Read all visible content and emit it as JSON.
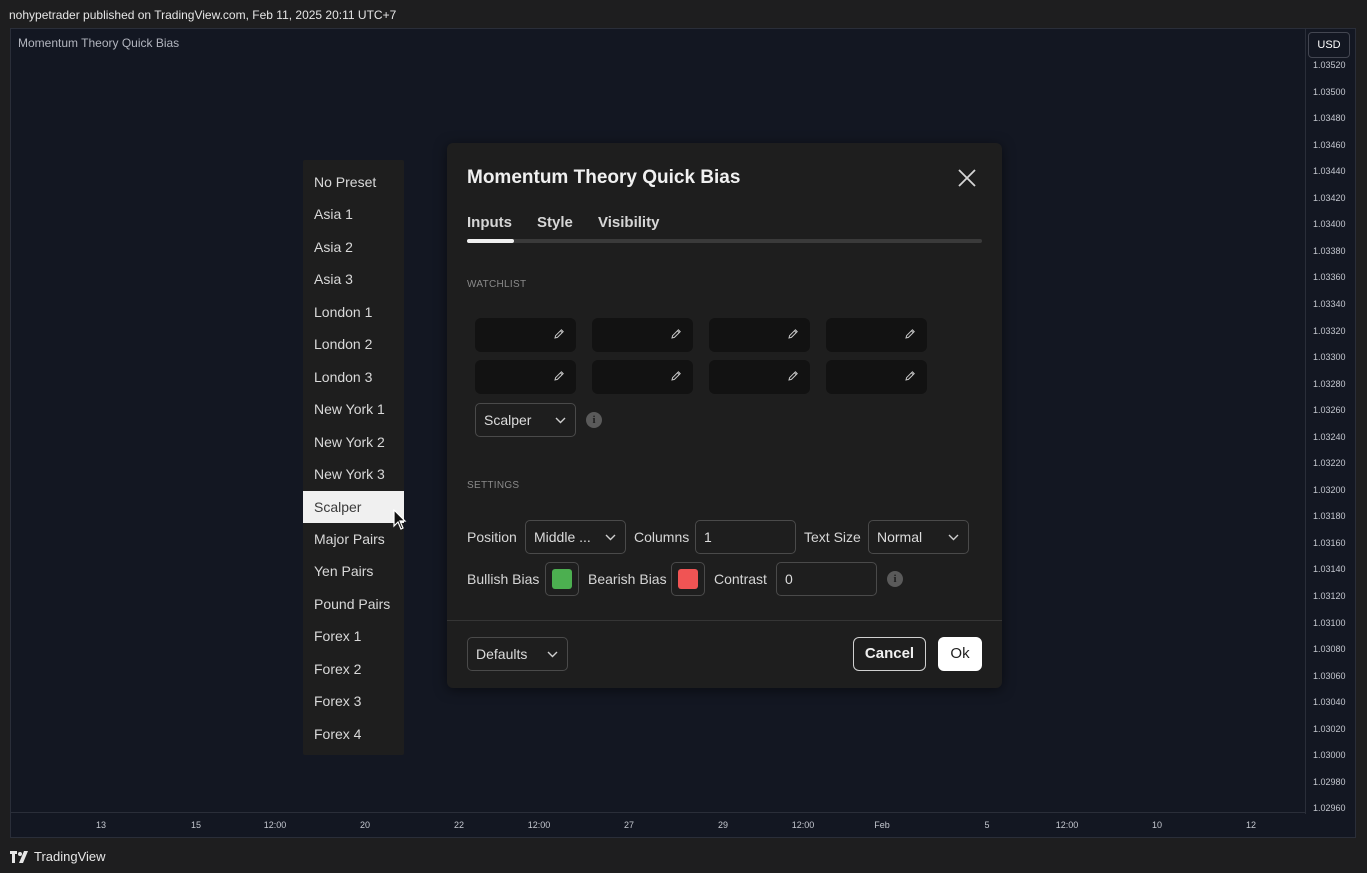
{
  "header": {
    "publish_info": "nohypetrader published on TradingView.com, Feb 11, 2025 20:11 UTC+7"
  },
  "chart": {
    "indicator_title": "Momentum Theory Quick Bias",
    "currency": "USD",
    "price_ticks": [
      "1.03520",
      "1.03500",
      "1.03480",
      "1.03460",
      "1.03440",
      "1.03420",
      "1.03400",
      "1.03380",
      "1.03360",
      "1.03340",
      "1.03320",
      "1.03300",
      "1.03280",
      "1.03260",
      "1.03240",
      "1.03220",
      "1.03200",
      "1.03180",
      "1.03160",
      "1.03140",
      "1.03120",
      "1.03100",
      "1.03080",
      "1.03060",
      "1.03040",
      "1.03020",
      "1.03000",
      "1.02980",
      "1.02960"
    ],
    "time_ticks": [
      "13",
      "15",
      "12:00",
      "20",
      "22",
      "12:00",
      "27",
      "29",
      "12:00",
      "Feb",
      "5",
      "12:00",
      "10",
      "12"
    ]
  },
  "footer": {
    "brand": "TradingView"
  },
  "preset_menu": {
    "items": [
      "No Preset",
      "Asia 1",
      "Asia 2",
      "Asia 3",
      "London 1",
      "London 2",
      "London 3",
      "New York 1",
      "New York 2",
      "New York 3",
      "Scalper",
      "Major Pairs",
      "Yen Pairs",
      "Pound Pairs",
      "Forex 1",
      "Forex 2",
      "Forex 3",
      "Forex 4"
    ],
    "selected": "Scalper"
  },
  "dialog": {
    "title": "Momentum Theory Quick Bias",
    "tabs": [
      "Inputs",
      "Style",
      "Visibility"
    ],
    "active_tab": "Inputs",
    "watchlist_label": "WATCHLIST",
    "preset_value": "Scalper",
    "settings_label": "SETTINGS",
    "position_label": "Position",
    "position_value": "Middle ...",
    "columns_label": "Columns",
    "columns_value": "1",
    "text_size_label": "Text Size",
    "text_size_value": "Normal",
    "bullish_label": "Bullish Bias",
    "bullish_color": "#4caf50",
    "bearish_label": "Bearish Bias",
    "bearish_color": "#f05454",
    "contrast_label": "Contrast",
    "contrast_value": "0",
    "defaults_label": "Defaults",
    "cancel_label": "Cancel",
    "ok_label": "Ok",
    "info_glyph": "i"
  }
}
